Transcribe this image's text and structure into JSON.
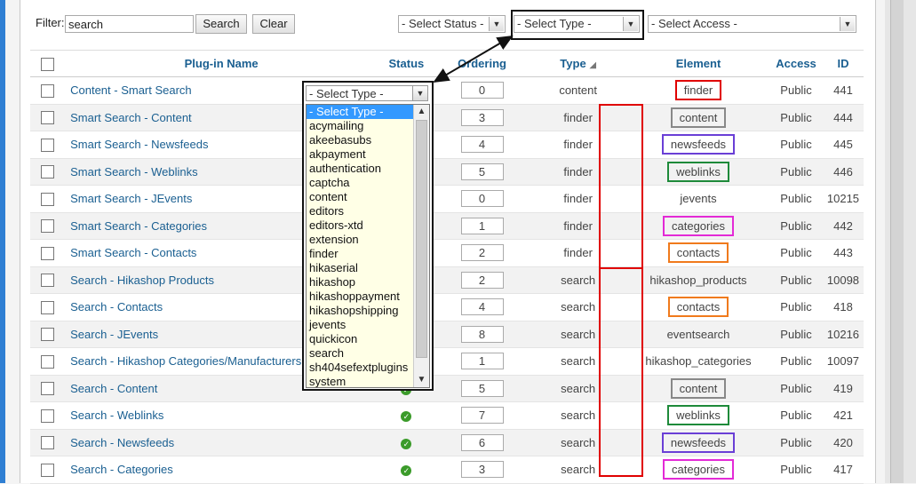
{
  "filter": {
    "label": "Filter:",
    "value": "search"
  },
  "toolbar": {
    "search_label": "Search",
    "clear_label": "Clear"
  },
  "selects": {
    "status": "- Select Status -",
    "type": "- Select Type -",
    "access": "- Select Access -"
  },
  "columns": {
    "name": "Plug-in Name",
    "status": "Status",
    "ordering": "Ordering",
    "type": "Type",
    "element": "Element",
    "access": "Access",
    "id": "ID"
  },
  "rows": [
    {
      "name": "Content - Smart Search",
      "status": "unpublished",
      "ordering": "0",
      "type": "content",
      "element": "finder",
      "access": "Public",
      "id": "441"
    },
    {
      "name": "Smart Search - Content",
      "status": "published",
      "ordering": "3",
      "type": "finder",
      "element": "content",
      "access": "Public",
      "id": "444"
    },
    {
      "name": "Smart Search - Newsfeeds",
      "status": "published",
      "ordering": "4",
      "type": "finder",
      "element": "newsfeeds",
      "access": "Public",
      "id": "445"
    },
    {
      "name": "Smart Search - Weblinks",
      "status": "published",
      "ordering": "5",
      "type": "finder",
      "element": "weblinks",
      "access": "Public",
      "id": "446"
    },
    {
      "name": "Smart Search - JEvents",
      "status": "unpublished",
      "ordering": "0",
      "type": "finder",
      "element": "jevents",
      "access": "Public",
      "id": "10215"
    },
    {
      "name": "Smart Search - Categories",
      "status": "published",
      "ordering": "1",
      "type": "finder",
      "element": "categories",
      "access": "Public",
      "id": "442"
    },
    {
      "name": "Smart Search - Contacts",
      "status": "published",
      "ordering": "2",
      "type": "finder",
      "element": "contacts",
      "access": "Public",
      "id": "443"
    },
    {
      "name": "Search - Hikashop Products",
      "status": "published",
      "ordering": "2",
      "type": "search",
      "element": "hikashop_products",
      "access": "Public",
      "id": "10098"
    },
    {
      "name": "Search - Contacts",
      "status": "published",
      "ordering": "4",
      "type": "search",
      "element": "contacts",
      "access": "Public",
      "id": "418"
    },
    {
      "name": "Search - JEvents",
      "status": "published",
      "ordering": "8",
      "type": "search",
      "element": "eventsearch",
      "access": "Public",
      "id": "10216"
    },
    {
      "name": "Search - Hikashop Categories/Manufacturers",
      "status": "published",
      "ordering": "1",
      "type": "search",
      "element": "hikashop_categories",
      "access": "Public",
      "id": "10097"
    },
    {
      "name": "Search - Content",
      "status": "published",
      "ordering": "5",
      "type": "search",
      "element": "content",
      "access": "Public",
      "id": "419"
    },
    {
      "name": "Search - Weblinks",
      "status": "published",
      "ordering": "7",
      "type": "search",
      "element": "weblinks",
      "access": "Public",
      "id": "421"
    },
    {
      "name": "Search - Newsfeeds",
      "status": "published",
      "ordering": "6",
      "type": "search",
      "element": "newsfeeds",
      "access": "Public",
      "id": "420"
    },
    {
      "name": "Search - Categories",
      "status": "published",
      "ordering": "3",
      "type": "search",
      "element": "categories",
      "access": "Public",
      "id": "417"
    }
  ],
  "element_highlight_colors": {
    "finder": "#e00000",
    "content": "#888888",
    "newsfeeds": "#6a3fd6",
    "weblinks": "#1e8a3a",
    "categories": "#e32ad6",
    "contacts": "#f07a1c"
  },
  "type_dropdown": {
    "header": "- Select Type -",
    "options": [
      "- Select Type -",
      "acymailing",
      "akeebasubs",
      "akpayment",
      "authentication",
      "captcha",
      "content",
      "editors",
      "editors-xtd",
      "extension",
      "finder",
      "hikaserial",
      "hikashop",
      "hikashoppayment",
      "hikashopshipping",
      "jevents",
      "quickicon",
      "search",
      "sh404sefextplugins",
      "system"
    ]
  }
}
